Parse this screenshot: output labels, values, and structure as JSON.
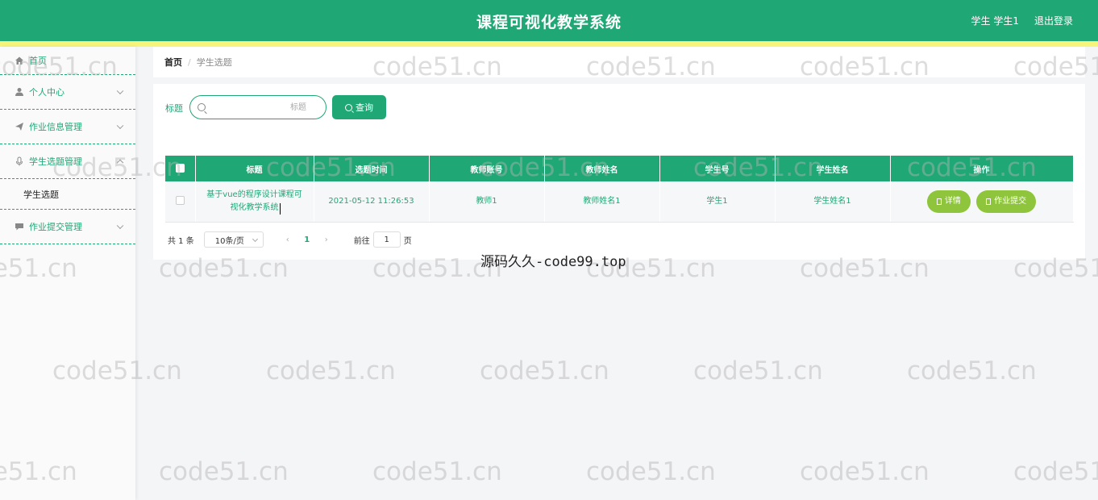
{
  "header": {
    "title": "课程可视化教学系统",
    "user": "学生 学生1",
    "logout": "退出登录"
  },
  "sidebar": {
    "items": [
      {
        "label": "首页",
        "icon": "home-icon"
      },
      {
        "label": "个人中心",
        "icon": "user-icon"
      },
      {
        "label": "作业信息管理",
        "icon": "send-icon"
      },
      {
        "label": "学生选题管理",
        "icon": "mic-icon"
      },
      {
        "label": "作业提交管理",
        "icon": "chat-icon"
      }
    ],
    "sub_item": "学生选题"
  },
  "breadcrumb": {
    "home": "首页",
    "sep": "/",
    "current": "学生选题"
  },
  "search": {
    "label": "标题",
    "placeholder": "标题",
    "button": "查询"
  },
  "table": {
    "headers": [
      "标题",
      "选题时间",
      "教师账号",
      "教师姓名",
      "学生号",
      "学生姓名",
      "操作"
    ],
    "rows": [
      {
        "title": "基于vue的程序设计课程可视化教学系统",
        "time": "2021-05-12 11:26:53",
        "teacher_account": "教师1",
        "teacher_name": "教师姓名1",
        "student_no": "学生1",
        "student_name": "学生姓名1"
      }
    ],
    "actions": {
      "detail": "详情",
      "submit": "作业提交"
    }
  },
  "pager": {
    "total": "共 1 条",
    "size": "10条/页",
    "page": "1",
    "goto": "前往",
    "goto_value": "1",
    "page_unit": "页"
  },
  "watermark": {
    "text": "code51.cn",
    "center": "源码久久-code99.top"
  },
  "colors": {
    "primary": "#1fa876",
    "accent_bar": "#f6f47a",
    "action_btn": "#8fc53c"
  }
}
